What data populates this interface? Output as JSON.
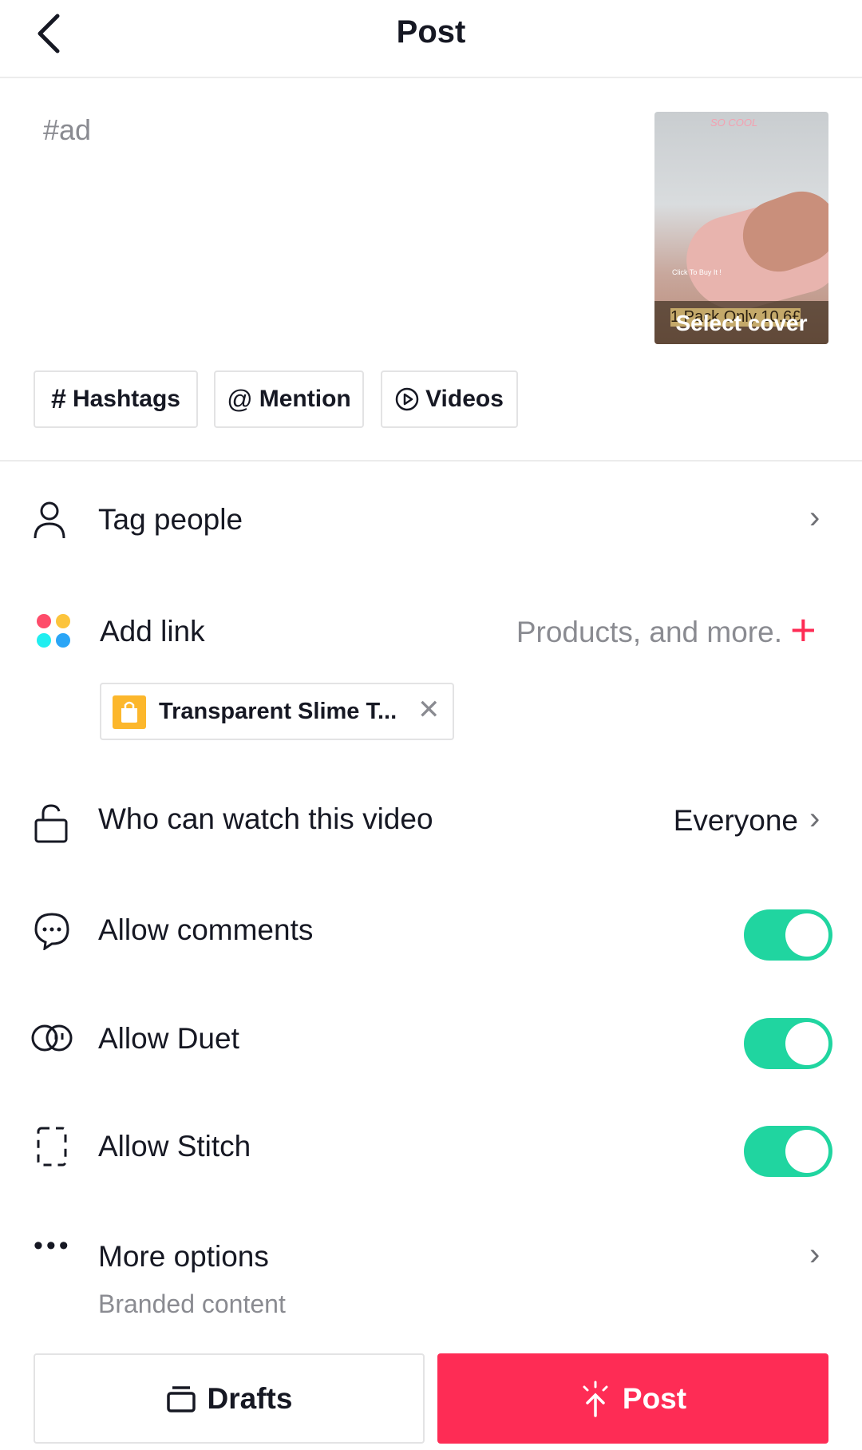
{
  "header": {
    "title": "Post"
  },
  "caption": {
    "value": "#ad"
  },
  "cover": {
    "label": "Select cover",
    "overlay_texts": [
      "SO COOL",
      "Click To Buy It !",
      "1 Pack Only 10.6£"
    ]
  },
  "quick_buttons": [
    {
      "icon": "hashtag-icon",
      "label": "Hashtags"
    },
    {
      "icon": "at-icon",
      "label": "Mention"
    },
    {
      "icon": "play-circle-icon",
      "label": "Videos"
    }
  ],
  "rows": {
    "tag_people": {
      "label": "Tag people"
    },
    "add_link": {
      "label": "Add link",
      "hint": "Products, and more.",
      "product": "Transparent Slime T..."
    },
    "who_can_watch": {
      "label": "Who can watch this video",
      "value": "Everyone"
    },
    "allow_comments": {
      "label": "Allow comments",
      "on": true
    },
    "allow_duet": {
      "label": "Allow Duet",
      "on": true
    },
    "allow_stitch": {
      "label": "Allow Stitch",
      "on": true
    },
    "more_options": {
      "label": "More options",
      "sub": "Branded content"
    }
  },
  "footer": {
    "drafts": "Drafts",
    "post": "Post"
  },
  "colors": {
    "accent": "#fe2c55",
    "toggle_on": "#20d5a0",
    "product_icon": "#fcb72c"
  }
}
